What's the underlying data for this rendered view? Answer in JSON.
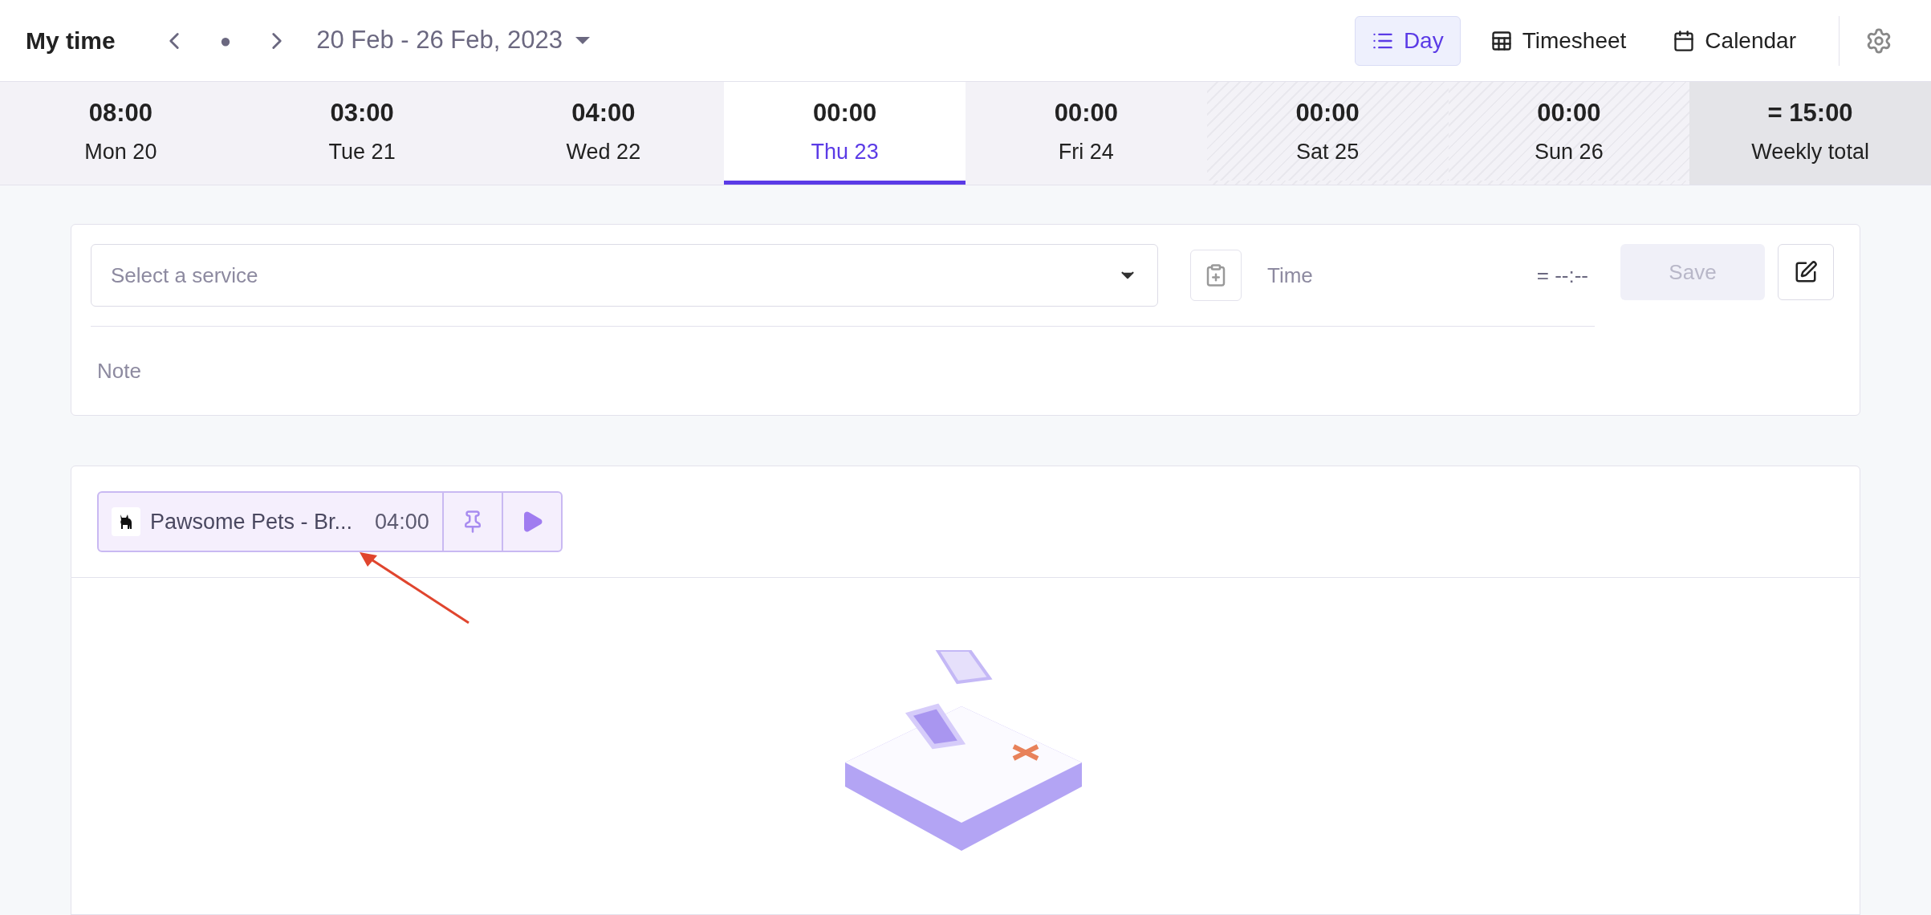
{
  "header": {
    "title": "My time",
    "today_dot": "●",
    "date_range": "20 Feb - 26 Feb, 2023",
    "views": [
      {
        "label": "Day",
        "selected": true
      },
      {
        "label": "Timesheet",
        "selected": false
      },
      {
        "label": "Calendar",
        "selected": false
      }
    ]
  },
  "days": [
    {
      "kind": "weekday",
      "time": "08:00",
      "label": "Mon 20",
      "selected": false
    },
    {
      "kind": "weekday",
      "time": "03:00",
      "label": "Tue 21",
      "selected": false
    },
    {
      "kind": "weekday",
      "time": "04:00",
      "label": "Wed 22",
      "selected": false
    },
    {
      "kind": "weekday",
      "time": "00:00",
      "label": "Thu 23",
      "selected": true
    },
    {
      "kind": "weekday",
      "time": "00:00",
      "label": "Fri 24",
      "selected": false
    },
    {
      "kind": "weekend",
      "time": "00:00",
      "label": "Sat 25",
      "selected": false
    },
    {
      "kind": "weekend",
      "time": "00:00",
      "label": "Sun 26",
      "selected": false
    },
    {
      "kind": "total",
      "time": "= 15:00",
      "label": "Weekly total",
      "selected": false
    }
  ],
  "entry_form": {
    "service": {
      "placeholder": "Select a service"
    },
    "time": {
      "placeholder": "Time"
    },
    "duration": "= --:--",
    "save": {
      "label": "Save",
      "disabled": true
    },
    "note": {
      "placeholder": "Note"
    }
  },
  "recent": [
    {
      "title": "Pawsome Pets - Br...",
      "duration": "04:00"
    }
  ]
}
